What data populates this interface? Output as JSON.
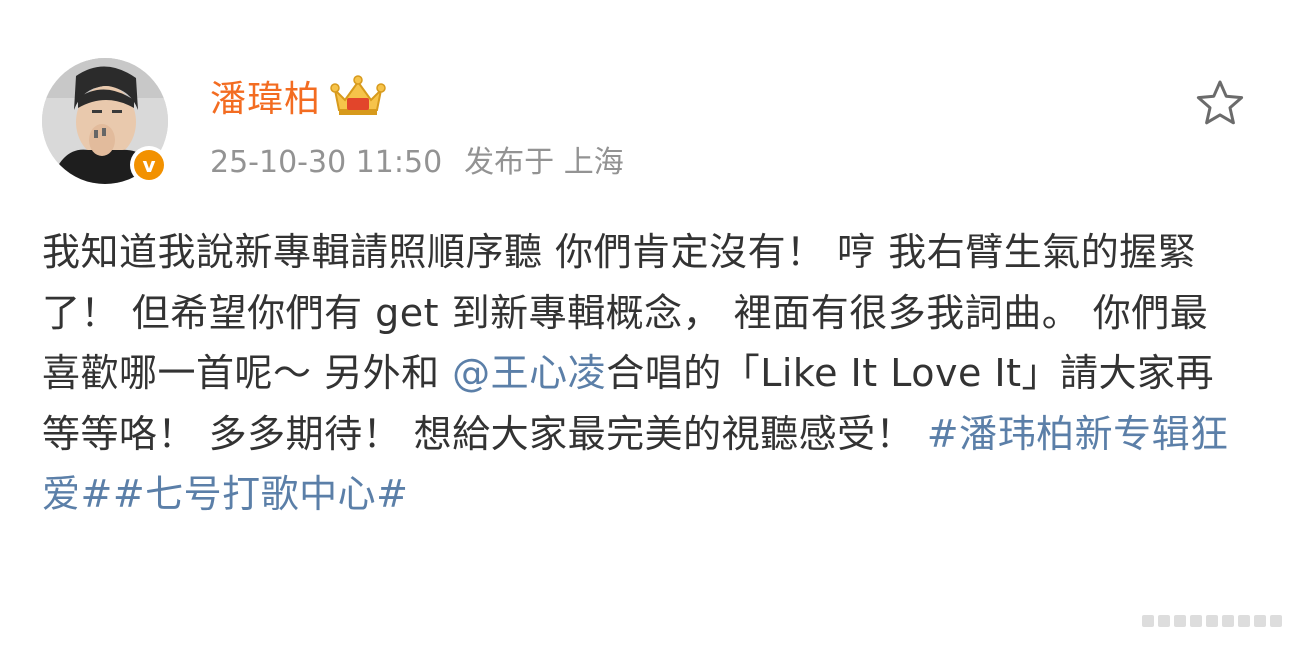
{
  "post": {
    "author": {
      "name": "潘瑋柏",
      "avatar_icon": "avatar-photo",
      "verified_icon": "verified-v-badge",
      "verified_glyph": "v",
      "vip_icon": "vip-crown-badge"
    },
    "timestamp": "25-10-30 11:50",
    "source": "发布于 上海",
    "favorite_icon": "star-outline-icon",
    "content": {
      "p1": "我知道我說新專輯請照順序聽 你們肯定沒有！ 哼 我右臂生氣的握緊了！ 但希望你們有 get 到新專輯概念， 裡面有很多我詞曲。 你們最喜歡哪一首呢～ 另外和 ",
      "mention": "@王心凌",
      "p2": "合唱的「Like It Love It」請大家再等等咯！ 多多期待！ 想給大家最完美的視聽感受！ ",
      "hashtag1": "#潘玮柏新专辑狂爱#",
      "hashtag2": "#七号打歌中心#"
    },
    "colors": {
      "username": "#f36c21",
      "link": "#5b7fa8",
      "meta": "#939393",
      "text": "#333333",
      "verified": "#f29100"
    }
  }
}
